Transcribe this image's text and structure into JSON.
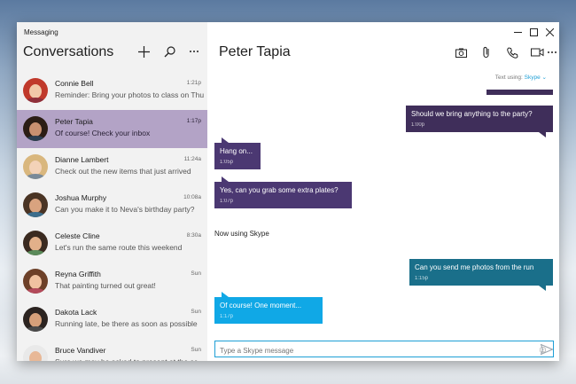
{
  "app": {
    "title": "Messaging"
  },
  "sidebar": {
    "header": "Conversations",
    "icons": {
      "new": "plus-icon",
      "search": "search-icon",
      "more": "more-icon"
    },
    "items": [
      {
        "name": "Connie Bell",
        "time": "1:21p",
        "preview": "Reminder: Bring your photos to class on Thu",
        "hair": "#c0392b",
        "skin": "#f1c8a8",
        "shirt": "#8e2f3a"
      },
      {
        "name": "Peter Tapia",
        "time": "1:17p",
        "preview": "Of course! Check your inbox",
        "hair": "#2b1d15",
        "skin": "#c89070",
        "shirt": "#2c3e50"
      },
      {
        "name": "Dianne Lambert",
        "time": "11:24a",
        "preview": "Check out the new items that just arrived",
        "hair": "#d9b77e",
        "skin": "#f3d2b8",
        "shirt": "#7a8a99"
      },
      {
        "name": "Joshua Murphy",
        "time": "10:08a",
        "preview": "Can you make it to Neva's birthday party?",
        "hair": "#4a3424",
        "skin": "#d9a37f",
        "shirt": "#3b6d8c"
      },
      {
        "name": "Celeste Cline",
        "time": "8:30a",
        "preview": "Let's run the same route this weekend",
        "hair": "#3a2a20",
        "skin": "#e2b08a",
        "shirt": "#5a8a5a"
      },
      {
        "name": "Reyna Griffith",
        "time": "Sun",
        "preview": "That painting turned out great!",
        "hair": "#6d4028",
        "skin": "#f0c2a0",
        "shirt": "#b34a5a"
      },
      {
        "name": "Dakota Lack",
        "time": "Sun",
        "preview": "Running late, be there as soon as possible",
        "hair": "#2b2320",
        "skin": "#d6a07a",
        "shirt": "#4a4a4a"
      },
      {
        "name": "Bruce Vandiver",
        "time": "Sun",
        "preview": "Sure we may be asked to present at the sc",
        "hair": "#e9e9e9",
        "skin": "#e8b897",
        "shirt": "#7c3a3a"
      }
    ],
    "selected_index": 1
  },
  "chat": {
    "title": "Peter Tapia",
    "tools": [
      "camera-icon",
      "attach-icon",
      "phone-icon",
      "video-icon",
      "more-icon"
    ],
    "window_controls": [
      "minimize-icon",
      "maximize-icon",
      "close-icon"
    ],
    "text_using_label": "Text using:",
    "text_using_service": "Skype",
    "messages": [
      {
        "dir": "out",
        "text": "Should we bring anything to the party?",
        "time": "1:00p"
      },
      {
        "dir": "in",
        "text": "Hang on...",
        "time": "1:05p"
      },
      {
        "dir": "in",
        "text": "Yes, can you grab some extra plates?",
        "time": "1:07p"
      },
      {
        "dir": "out",
        "text": "Can you send me photos from the run",
        "time": "1:15p"
      },
      {
        "dir": "in",
        "text": "Of course!  One moment...",
        "time": "1:17p"
      }
    ],
    "system_line": "Now using Skype",
    "composer_placeholder": "Type a Skype message"
  },
  "colors": {
    "selected_row": "#b3a3c6",
    "purple_out": "#3f2e5a",
    "purple_in": "#4b3872",
    "teal_out": "#1a6f8a",
    "blue_in": "#10a8e6",
    "accent": "#1e9fd6"
  }
}
